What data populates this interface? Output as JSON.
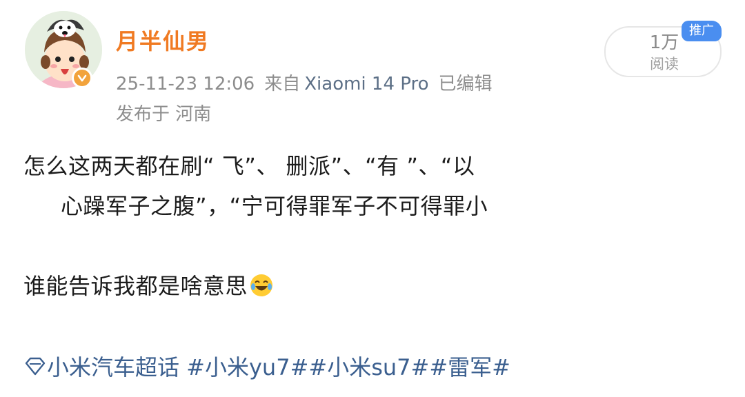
{
  "post": {
    "author": "月半仙男",
    "timestamp": "25-11-23 12:06",
    "source_prefix": "来自",
    "device": "Xiaomi 14 Pro",
    "edited": "已编辑",
    "location": "发布于 河南",
    "reads": {
      "count": "1万",
      "label": "阅读"
    },
    "ad_badge": "推广",
    "body": {
      "line1": "怎么这两天都在刷“    飞”、   删派”、“有   ”、“以",
      "line2": "心躁军子之腹”，“宁可得罪军子不可得罪小",
      "line3": "谁能告诉我都是啥意思"
    },
    "topics": "小米汽车超话 #小米yu7##小米su7##雷军#",
    "icons": {
      "avatar": "husky-cartoon-avatar",
      "verified": "orange-verified-badge-icon",
      "emoji": "laughing-tears-emoji-icon",
      "supertopic": "diamond-supertopic-icon"
    },
    "colors": {
      "author": "#f07a22",
      "meta": "#8d8d8d",
      "topic": "#3b5f8f",
      "ad_badge": "#4a8ef0"
    }
  }
}
